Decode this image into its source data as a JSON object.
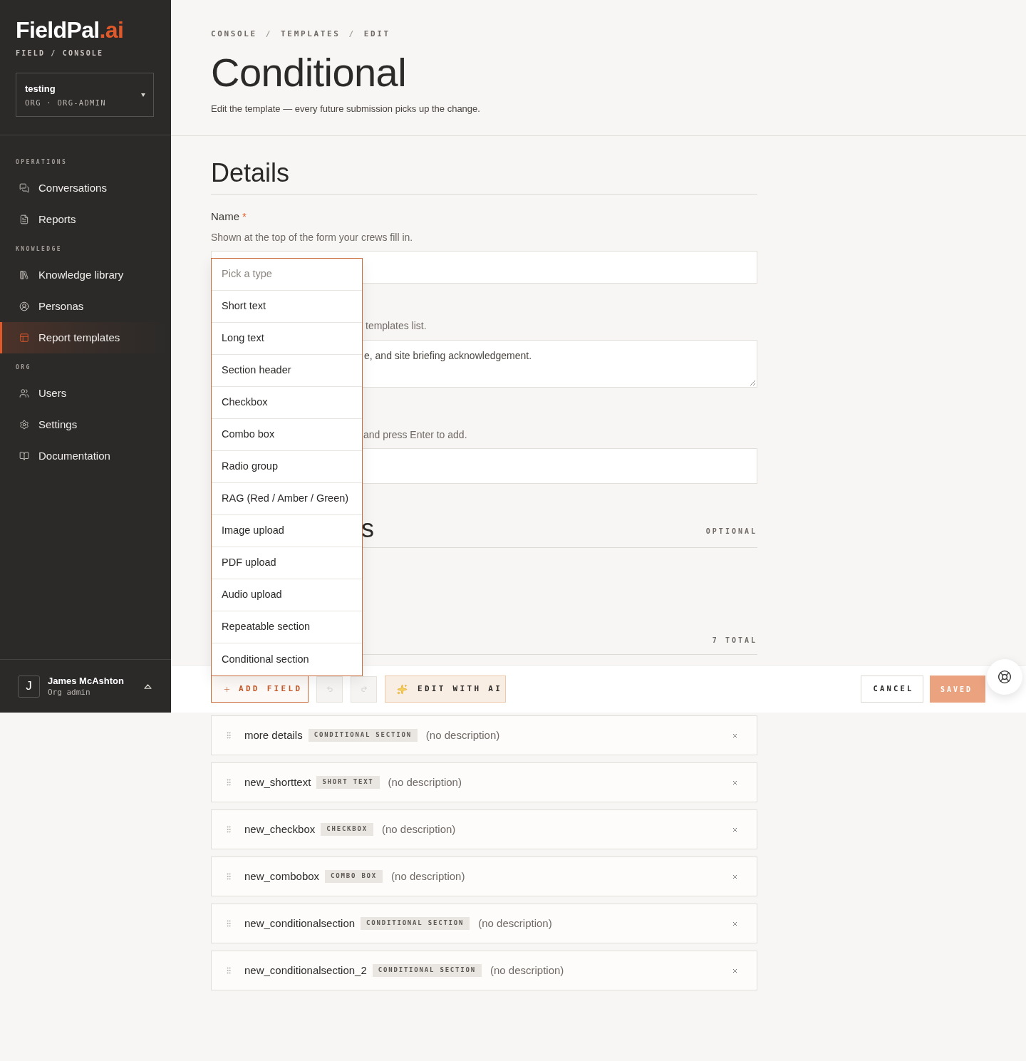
{
  "sidebar": {
    "logo": {
      "name": "FieldPal",
      "suffix": ".ai"
    },
    "tagline": "FIELD / CONSOLE",
    "org": {
      "name": "testing",
      "role": "ORG · ORG-ADMIN"
    },
    "sections": [
      {
        "label": "OPERATIONS",
        "items": [
          {
            "label": "Conversations",
            "selected": false
          },
          {
            "label": "Reports",
            "selected": false
          }
        ]
      },
      {
        "label": "KNOWLEDGE",
        "items": [
          {
            "label": "Knowledge library",
            "selected": false
          },
          {
            "label": "Personas",
            "selected": false
          },
          {
            "label": "Report templates",
            "selected": true
          }
        ]
      },
      {
        "label": "ORG",
        "items": [
          {
            "label": "Users",
            "selected": false
          },
          {
            "label": "Settings",
            "selected": false
          },
          {
            "label": "Documentation",
            "selected": false
          }
        ]
      }
    ],
    "user": {
      "initial": "J",
      "name": "James McAshton",
      "role": "Org admin"
    }
  },
  "header": {
    "breadcrumb": {
      "items": [
        "CONSOLE",
        "TEMPLATES",
        "EDIT"
      ],
      "separator": "/"
    },
    "title": "Conditional",
    "subtitle": "Edit the template — every future submission picks up the change."
  },
  "details": {
    "title": "Details",
    "name_field": {
      "label": "Name",
      "required": true,
      "required_mark": "*",
      "hint": "Shown at the top of the form your crews fill in."
    },
    "field_2": {
      "hint": "templates list.",
      "value": "e, and site briefing acknowledgement."
    },
    "field_3": {
      "hint": "and press Enter to add."
    }
  },
  "section_2": {
    "title": "s",
    "note": "OPTIONAL"
  },
  "fields_summary": {
    "count": "7 TOTAL"
  },
  "type_menu": {
    "placeholder": "Pick a type",
    "options": [
      {
        "label": "Short text",
        "selected": false
      },
      {
        "label": "Long text",
        "selected": false
      },
      {
        "label": "Section header",
        "selected": false
      },
      {
        "label": "Checkbox",
        "selected": false
      },
      {
        "label": "Combo box",
        "selected": false
      },
      {
        "label": "Radio group",
        "selected": false
      },
      {
        "label": "RAG (Red / Amber / Green)",
        "selected": false
      },
      {
        "label": "Image upload",
        "selected": false
      },
      {
        "label": "PDF upload",
        "selected": false
      },
      {
        "label": "Audio upload",
        "selected": false
      },
      {
        "label": "Repeatable section",
        "selected": false
      },
      {
        "label": "Conditional section",
        "selected": false
      }
    ]
  },
  "action_bar": {
    "add_field": "ADD FIELD",
    "undo": {
      "disabled": true
    },
    "redo": {
      "disabled": true
    },
    "edit_with_ai": "EDIT WITH AI",
    "cancel": "CANCEL",
    "save": {
      "label": "SAVED",
      "disabled": true
    }
  },
  "fields": [
    {
      "name": "more details",
      "type": "CONDITIONAL SECTION",
      "description": "(no description)"
    },
    {
      "name": "new_shorttext",
      "type": "SHORT TEXT",
      "description": "(no description)"
    },
    {
      "name": "new_checkbox",
      "type": "CHECKBOX",
      "description": "(no description)"
    },
    {
      "name": "new_combobox",
      "type": "COMBO BOX",
      "description": "(no description)"
    },
    {
      "name": "new_conditionalsection",
      "type": "CONDITIONAL SECTION",
      "description": "(no description)"
    },
    {
      "name": "new_conditionalsection_2",
      "type": "CONDITIONAL SECTION",
      "description": "(no description)"
    }
  ]
}
